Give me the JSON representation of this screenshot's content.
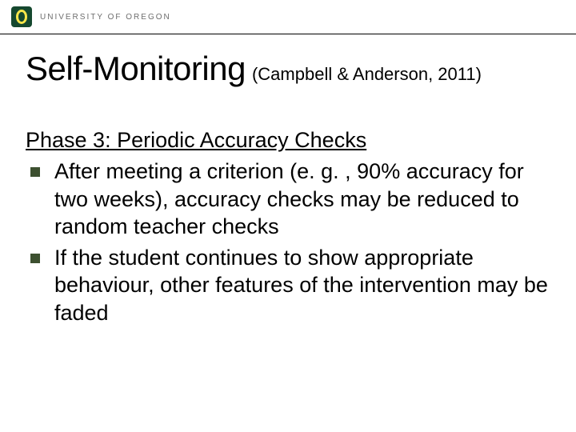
{
  "header": {
    "institution": "UNIVERSITY OF OREGON"
  },
  "title": {
    "main": "Self-Monitoring",
    "citation": "(Campbell & Anderson, 2011)"
  },
  "content": {
    "subheading": "Phase 3: Periodic Accuracy Checks",
    "bullets": [
      "After meeting a criterion (e. g. , 90% accuracy for two weeks), accuracy checks may be reduced to random teacher checks",
      "If the student continues to show appropriate behaviour, other features of the intervention may be faded"
    ]
  },
  "colors": {
    "bullet": "#3d5030",
    "logo_bg": "#15482f",
    "logo_o": "#f7e64a"
  }
}
